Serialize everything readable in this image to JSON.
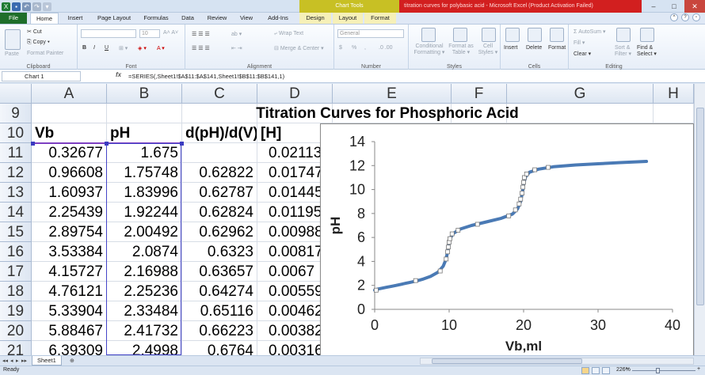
{
  "window": {
    "context_tab_band": "Chart Tools",
    "title": "titration curves for polybasic acid  -  Microsoft Excel (Product Activation Failed)",
    "controls": [
      "–",
      "□",
      "✕"
    ]
  },
  "qat": {
    "icons": [
      "excel-logo-icon",
      "save-icon",
      "undo-icon",
      "redo-icon",
      "customize-icon"
    ]
  },
  "tabs": [
    "File",
    "Home",
    "Insert",
    "Page Layout",
    "Formulas",
    "Data",
    "Review",
    "View",
    "Add-Ins",
    "Design",
    "Layout",
    "Format"
  ],
  "ribbon": {
    "clipboard": {
      "paste": "Paste",
      "cut": "Cut",
      "copy": "Copy ▾",
      "format_painter": "Format Painter",
      "label": "Clipboard"
    },
    "font": {
      "size": "10",
      "label": "Font",
      "bold": "B",
      "italic": "I",
      "underline": "U"
    },
    "alignment": {
      "wrap_text": "Wrap Text",
      "merge_center": "Merge & Center ▾",
      "label": "Alignment"
    },
    "number": {
      "format": "General",
      "currency": "$",
      "percent": "%",
      "comma": ",",
      "label": "Number"
    },
    "styles": {
      "conditional": "Conditional Formatting ▾",
      "format_table": "Format as Table ▾",
      "cell_styles": "Cell Styles ▾",
      "label": "Styles"
    },
    "cells": {
      "insert": "Insert",
      "delete": "Delete",
      "format": "Format",
      "label": "Cells"
    },
    "editing": {
      "autosum": "Σ AutoSum ▾",
      "fill": "Fill ▾",
      "clear": "Clear ▾",
      "sort_filter": "Sort & Filter ▾",
      "find_select": "Find & Select ▾",
      "label": "Editing"
    }
  },
  "formula_bar": {
    "name_box": "Chart 1",
    "fx": "fx",
    "formula": "=SERIES(,Sheet1!$A$11:$A$141,Sheet1!$B$11:$B$141,1)"
  },
  "grid": {
    "columns": [
      "A",
      "B",
      "C",
      "D",
      "E",
      "F",
      "G",
      "H"
    ],
    "sheet_title": "Titration Curves for Phosphoric Acid",
    "rows": [
      {
        "row": "9",
        "cells": [
          "",
          "",
          "",
          "",
          "",
          "",
          "",
          ""
        ]
      },
      {
        "row": "10",
        "cells": [
          "Vb",
          "pH",
          "d(pH)/d(V)",
          "[H]",
          "",
          "",
          "",
          ""
        ]
      },
      {
        "row": "11",
        "cells": [
          "0.32677",
          "1.675",
          "",
          "0.02113",
          "",
          "",
          "",
          ""
        ]
      },
      {
        "row": "12",
        "cells": [
          "0.96608",
          "1.75748",
          "0.62822",
          "0.01747",
          "",
          "",
          "",
          ""
        ]
      },
      {
        "row": "13",
        "cells": [
          "1.60937",
          "1.83996",
          "0.62787",
          "0.01445",
          "",
          "",
          "",
          ""
        ]
      },
      {
        "row": "14",
        "cells": [
          "2.25439",
          "1.92244",
          "0.62824",
          "0.01195",
          "",
          "",
          "",
          ""
        ]
      },
      {
        "row": "15",
        "cells": [
          "2.89754",
          "2.00492",
          "0.62962",
          "0.00988",
          "",
          "",
          "",
          ""
        ]
      },
      {
        "row": "16",
        "cells": [
          "3.53384",
          "2.0874",
          "0.6323",
          "0.00817",
          "",
          "",
          "",
          ""
        ]
      },
      {
        "row": "17",
        "cells": [
          "4.15727",
          "2.16988",
          "0.63657",
          "0.0067",
          "",
          "",
          "",
          ""
        ]
      },
      {
        "row": "18",
        "cells": [
          "4.76121",
          "2.25236",
          "0.64274",
          "0.00559",
          "",
          "",
          "",
          ""
        ]
      },
      {
        "row": "19",
        "cells": [
          "5.33904",
          "2.33484",
          "0.65116",
          "0.00462",
          "",
          "",
          "",
          ""
        ]
      },
      {
        "row": "20",
        "cells": [
          "5.88467",
          "2.41732",
          "0.66223",
          "0.00382",
          "",
          "",
          "",
          ""
        ]
      },
      {
        "row": "21",
        "cells": [
          "6.39309",
          "2.4998",
          "0.6764",
          "0.00316",
          "",
          "",
          "",
          ""
        ]
      }
    ]
  },
  "chart_data": {
    "type": "scatter",
    "title": "",
    "xlabel": "Vb,ml",
    "ylabel": "pH",
    "xlim": [
      0,
      40
    ],
    "ylim": [
      0,
      14
    ],
    "xticks": [
      "0",
      "10",
      "20",
      "30",
      "40"
    ],
    "yticks": [
      "0",
      "2",
      "4",
      "6",
      "8",
      "10",
      "12",
      "14"
    ],
    "grid": false,
    "legend": "none",
    "series_color": "#4a7ab5",
    "series": [
      {
        "values": [
          [
            0.0,
            1.6
          ],
          [
            0.33,
            1.68
          ],
          [
            0.97,
            1.76
          ],
          [
            1.61,
            1.84
          ],
          [
            2.25,
            1.92
          ],
          [
            2.9,
            2.0
          ],
          [
            3.53,
            2.09
          ],
          [
            4.16,
            2.17
          ],
          [
            4.76,
            2.25
          ],
          [
            5.34,
            2.33
          ],
          [
            5.88,
            2.42
          ],
          [
            6.39,
            2.5
          ],
          [
            7.5,
            2.75
          ],
          [
            8.5,
            3.1
          ],
          [
            9.2,
            3.6
          ],
          [
            9.6,
            4.2
          ],
          [
            9.85,
            5.0
          ],
          [
            10.0,
            5.6
          ],
          [
            10.2,
            6.0
          ],
          [
            10.6,
            6.35
          ],
          [
            11.5,
            6.7
          ],
          [
            13,
            7.0
          ],
          [
            15,
            7.3
          ],
          [
            17,
            7.6
          ],
          [
            18.5,
            7.95
          ],
          [
            19.2,
            8.4
          ],
          [
            19.6,
            9.0
          ],
          [
            19.85,
            9.8
          ],
          [
            20.05,
            10.6
          ],
          [
            20.3,
            11.1
          ],
          [
            20.8,
            11.45
          ],
          [
            22,
            11.7
          ],
          [
            24,
            11.9
          ],
          [
            27,
            12.05
          ],
          [
            30,
            12.15
          ],
          [
            33,
            12.25
          ],
          [
            36.5,
            12.35
          ]
        ]
      }
    ],
    "markers": [
      [
        0.2,
        1.6
      ],
      [
        5.5,
        2.4
      ],
      [
        8.8,
        3.2
      ],
      [
        9.6,
        4.2
      ],
      [
        9.8,
        4.8
      ],
      [
        9.9,
        5.2
      ],
      [
        10.0,
        5.6
      ],
      [
        10.1,
        5.9
      ],
      [
        10.4,
        6.3
      ],
      [
        11.2,
        6.6
      ],
      [
        13.8,
        7.1
      ],
      [
        18.0,
        7.8
      ],
      [
        18.9,
        8.3
      ],
      [
        19.4,
        8.8
      ],
      [
        19.6,
        9.2
      ],
      [
        19.8,
        9.7
      ],
      [
        19.9,
        10.2
      ],
      [
        20.0,
        10.6
      ],
      [
        20.1,
        11.0
      ],
      [
        20.4,
        11.3
      ],
      [
        21.5,
        11.65
      ],
      [
        23.3,
        11.85
      ]
    ]
  },
  "bottom": {
    "nav": [
      "◂◂",
      "◂",
      "▸",
      "▸▸"
    ],
    "sheet_tab": "Sheet1"
  },
  "status": {
    "ready": "Ready",
    "zoom": "226%",
    "zoom_out": "−",
    "zoom_in": "+"
  }
}
